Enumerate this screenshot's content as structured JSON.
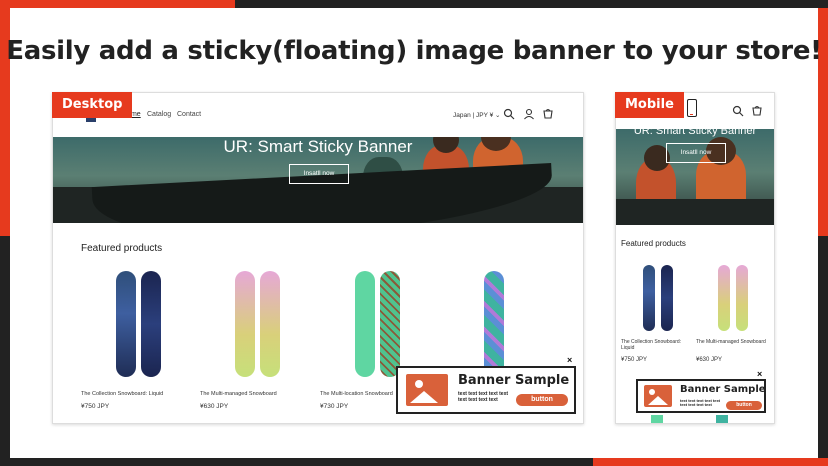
{
  "headline": "Easily add a sticky(floating) image banner to your store!",
  "desktop": {
    "tag": "Desktop",
    "nav": {
      "home": "Home",
      "catalog": "Catalog",
      "contact": "Contact",
      "locale": "Japan | JPY ¥ ⌄"
    },
    "hero": {
      "title": "UR: Smart Sticky Banner",
      "button": "Insatll now"
    },
    "featured_title": "Featured products",
    "products": [
      {
        "name": "The Collection Snowboard: Liquid",
        "price": "¥750 JPY"
      },
      {
        "name": "The Multi-managed Snowboard",
        "price": "¥630 JPY"
      },
      {
        "name": "The Multi-location Snowboard",
        "price": "¥730 JPY"
      },
      {
        "name": "",
        "price": ""
      }
    ]
  },
  "mobile": {
    "tag": "Mobile",
    "hero": {
      "title": "UR: Smart Sticky Banner",
      "button": "Insatll now"
    },
    "featured_title": "Featured products",
    "products": [
      {
        "name": "The Collection Snowboard: Liquid",
        "price": "¥750 JPY"
      },
      {
        "name": "The Multi-managed Snowboard",
        "price": "¥630 JPY"
      }
    ]
  },
  "banner": {
    "title": "Banner Sample",
    "text": "text text text text text text text text text",
    "button": "button",
    "close": "×"
  },
  "colors": {
    "accent": "#e63a1e",
    "banner_accent": "#d9613a",
    "dark": "#222222"
  }
}
